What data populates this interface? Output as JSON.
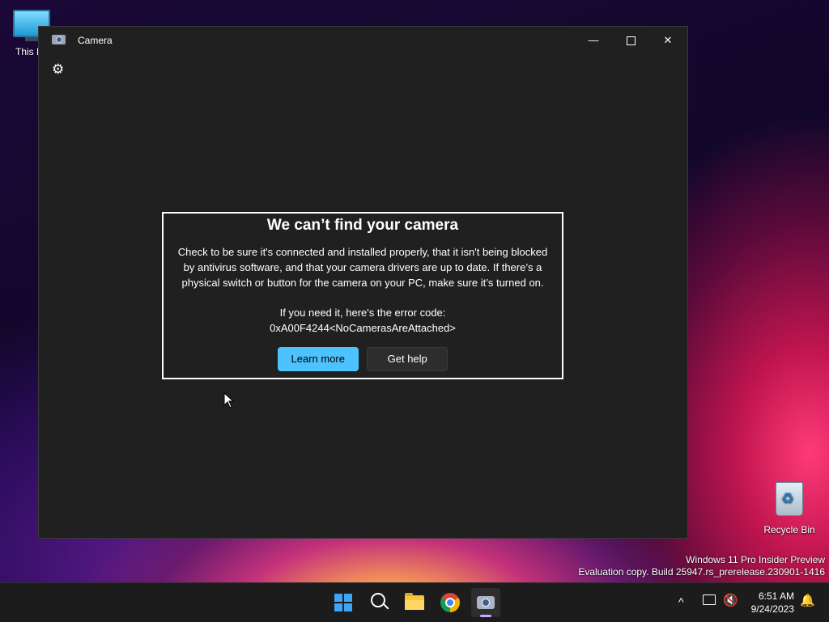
{
  "desktop": {
    "this_pc_label": "This PC",
    "recycle_bin_label": "Recycle Bin",
    "watermark_line1": "Windows 11 Pro Insider Preview",
    "watermark_line2": "Evaluation copy. Build 25947.rs_prerelease.230901-1416"
  },
  "window": {
    "title": "Camera",
    "minimize_glyph": "—",
    "close_glyph": "✕",
    "settings_glyph": "⚙"
  },
  "dialog": {
    "title": "We can’t find your camera",
    "body_line1": "Check to be sure it's connected and installed properly, that it isn't being blocked",
    "body_line2": "by antivirus software, and that your camera drivers are up to date. If there’s a",
    "body_line3": "physical switch or button for the camera on your PC, make sure it’s turned on.",
    "error_intro": "If you need it, here's the error code:",
    "error_code": "0xA00F4244<NoCamerasAreAttached>",
    "learn_more_label": "Learn more",
    "get_help_label": "Get help"
  },
  "taskbar": {
    "apps": [
      "start",
      "search",
      "file-explorer",
      "chrome",
      "camera"
    ],
    "active_app": "camera",
    "tray_chevron": "^",
    "volume_glyph": "🔇",
    "bell_glyph": "🔔",
    "time": "6:51 AM",
    "date": "9/24/2023"
  },
  "colors": {
    "accent": "#4cc2ff",
    "window_bg": "#202020"
  }
}
